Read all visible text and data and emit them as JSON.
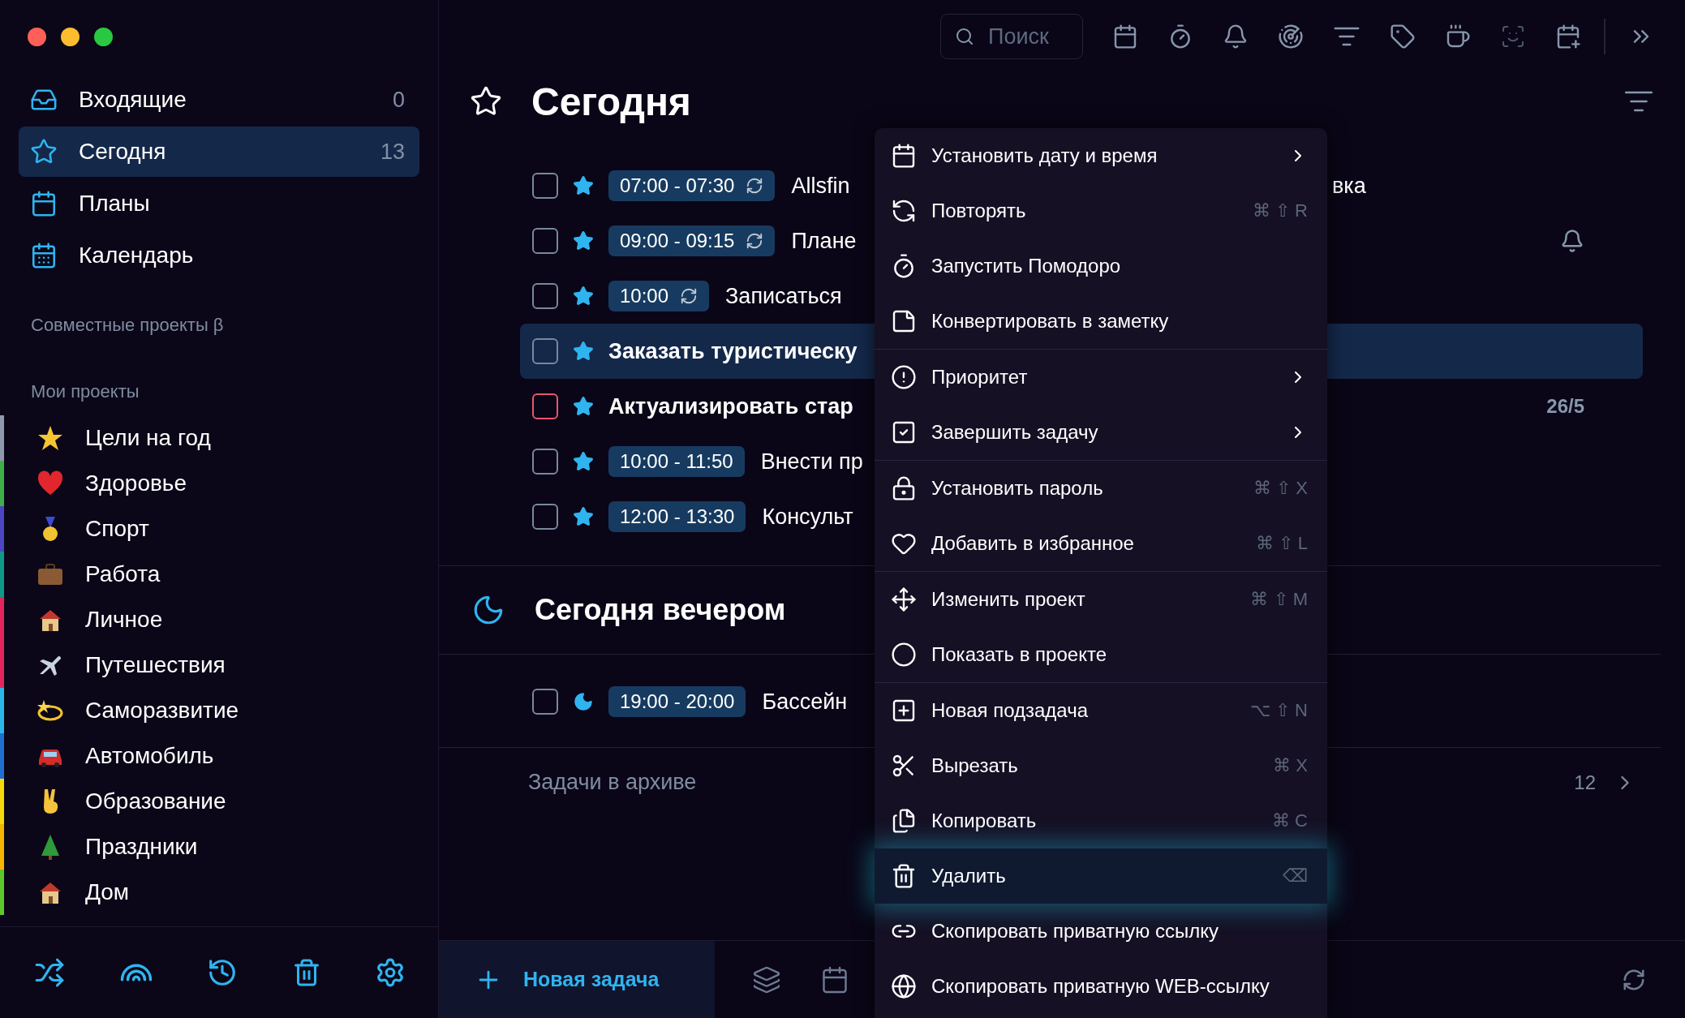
{
  "sidebar": {
    "nav": [
      {
        "label": "Входящие",
        "count": "0",
        "selected": false
      },
      {
        "label": "Сегодня",
        "count": "13",
        "selected": true
      },
      {
        "label": "Планы",
        "selected": false
      },
      {
        "label": "Календарь",
        "selected": false
      }
    ],
    "shared_heading": "Совместные проекты β",
    "projects_heading": "Мои проекты",
    "projects": [
      {
        "name": "Цели на год",
        "color": "#8e9aab"
      },
      {
        "name": "Здоровье",
        "color": "#3fae49"
      },
      {
        "name": "Спорт",
        "color": "#4b47c2"
      },
      {
        "name": "Работа",
        "color": "#0f9a88"
      },
      {
        "name": "Личное",
        "color": "#e3245f"
      },
      {
        "name": "Путешествия",
        "color": "#e3245f"
      },
      {
        "name": "Саморазвитие",
        "color": "#2bb6ea"
      },
      {
        "name": "Автомобиль",
        "color": "#1f6fd2"
      },
      {
        "name": "Образование",
        "color": "#f4da0c"
      },
      {
        "name": "Праздники",
        "color": "#f5b400"
      },
      {
        "name": "Дом",
        "color": "#5cc82c"
      }
    ]
  },
  "toolbar": {
    "search": {
      "placeholder": "Поиск"
    }
  },
  "main": {
    "title": "Сегодня",
    "tasks": [
      {
        "kind": "star",
        "time": "07:00 - 07:30",
        "repeat": true,
        "title": "Allsfin",
        "tail": "вка",
        "color": "#7a889c",
        "bold": false,
        "selected": false,
        "reminder": false
      },
      {
        "kind": "star",
        "time": "09:00 - 09:15",
        "repeat": true,
        "title": "Плане",
        "color": "#7a889c",
        "bold": false,
        "selected": false,
        "reminder": true
      },
      {
        "kind": "star",
        "time": "10:00",
        "repeat": true,
        "title": "Записаться",
        "color": "#7a889c",
        "bold": false,
        "selected": false,
        "reminder": false
      },
      {
        "kind": "star",
        "title": "Заказать туристическу",
        "color": "#7a889c",
        "bold": true,
        "selected": true,
        "reminder": false
      },
      {
        "kind": "star",
        "title": "Актуализировать стар",
        "date": "26/5",
        "color": "#e8566b",
        "bold": true,
        "selected": false,
        "reminder": false
      },
      {
        "kind": "star",
        "time": "10:00 - 11:50",
        "repeat": false,
        "title": "Внести пр",
        "color": "#7a889c",
        "bold": false,
        "selected": false,
        "reminder": false
      },
      {
        "kind": "star",
        "time": "12:00 - 13:30",
        "repeat": false,
        "title": "Консульт",
        "color": "#7a889c",
        "bold": false,
        "selected": false,
        "reminder": false
      }
    ],
    "evening": {
      "title": "Сегодня вечером",
      "tasks": [
        {
          "kind": "moon",
          "time": "19:00 - 20:00",
          "repeat": false,
          "title": "Бассейн",
          "color": "#7a889c",
          "bold": false,
          "selected": false,
          "reminder": false
        }
      ]
    },
    "archive": {
      "label": "Задачи в архиве",
      "count": "12"
    },
    "new_task": "Новая задача"
  },
  "menu": {
    "groups": [
      [
        {
          "label": "Установить дату и время",
          "submenu": true,
          "highlighted": false
        },
        {
          "label": "Повторять",
          "shortcut": "⌘ ⇧ R",
          "highlighted": false
        },
        {
          "label": "Запустить Помодоро",
          "highlighted": false
        },
        {
          "label": "Конвертировать в заметку",
          "highlighted": false
        }
      ],
      [
        {
          "label": "Приоритет",
          "submenu": true,
          "highlighted": false
        },
        {
          "label": "Завершить задачу",
          "submenu": true,
          "highlighted": false
        }
      ],
      [
        {
          "label": "Установить пароль",
          "shortcut": "⌘ ⇧ X",
          "highlighted": false
        },
        {
          "label": "Добавить в избранное",
          "shortcut": "⌘ ⇧ L",
          "highlighted": false
        }
      ],
      [
        {
          "label": "Изменить проект",
          "shortcut": "⌘ ⇧ M",
          "highlighted": false
        },
        {
          "label": "Показать в проекте",
          "highlighted": false
        }
      ],
      [
        {
          "label": "Новая подзадача",
          "shortcut": "⌥ ⇧ N",
          "highlighted": false
        },
        {
          "label": "Вырезать",
          "shortcut": "⌘ X",
          "highlighted": false
        },
        {
          "label": "Копировать",
          "shortcut": "⌘ C",
          "highlighted": false
        },
        {
          "label": "Удалить",
          "shortcut": "⌫",
          "highlighted": true
        },
        {
          "label": "Скопировать приватную ссылку",
          "highlighted": false
        },
        {
          "label": "Скопировать приватную WEB-ссылку",
          "highlighted": false
        }
      ]
    ]
  }
}
